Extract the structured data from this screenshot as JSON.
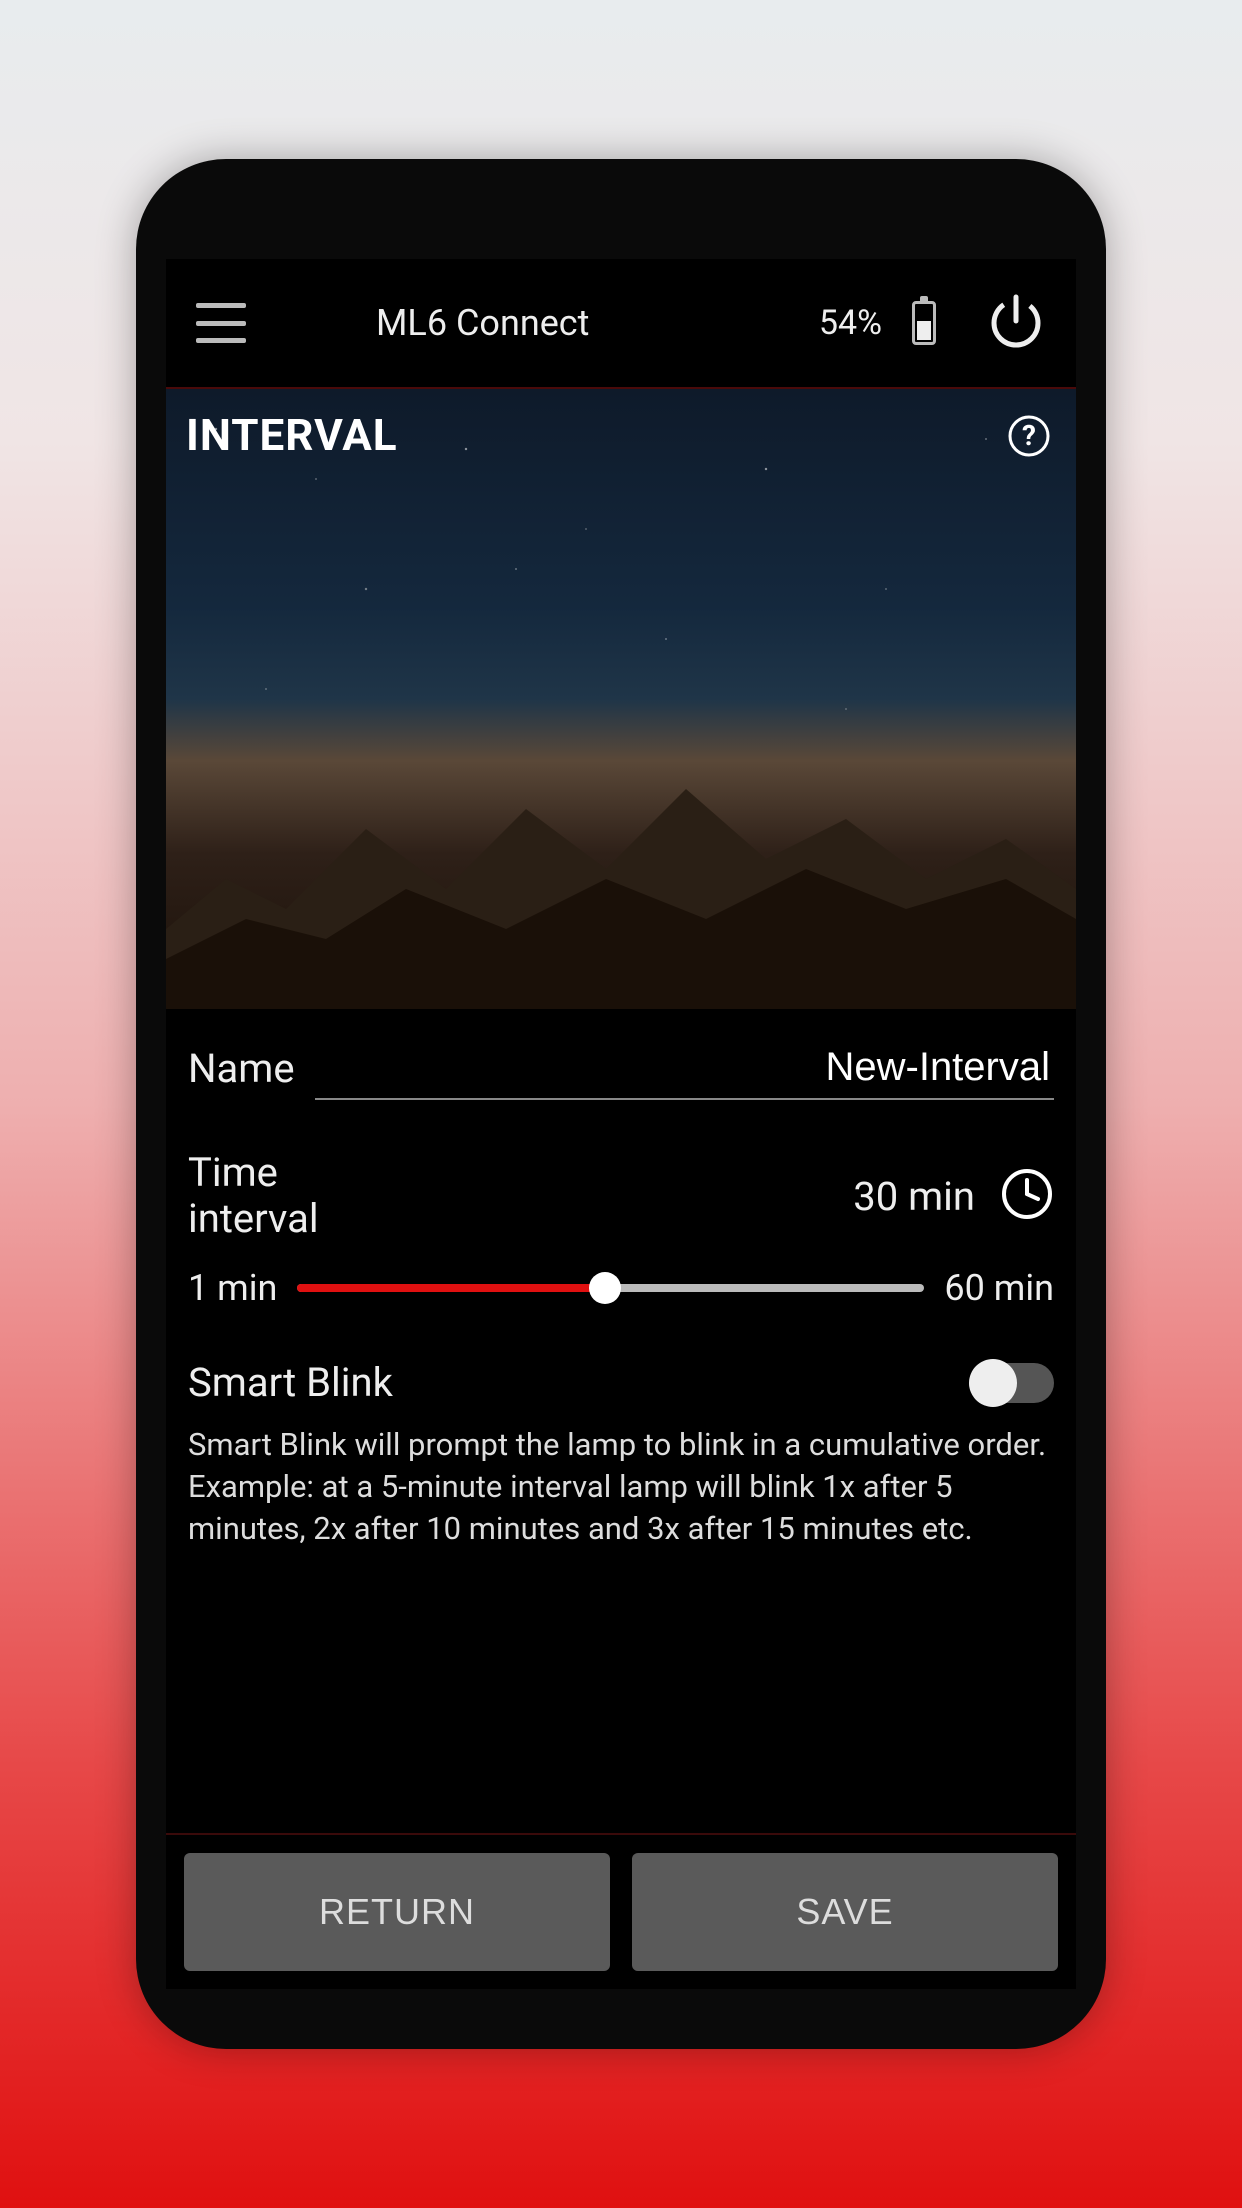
{
  "header": {
    "app_title": "ML6 Connect",
    "battery_pct": "54%"
  },
  "section": {
    "title": "INTERVAL"
  },
  "name_field": {
    "label": "Name",
    "value": "New-Interval"
  },
  "time_interval": {
    "label_line1": "Time",
    "label_line2": "interval",
    "value": "30 min",
    "min_label": "1 min",
    "max_label": "60 min",
    "min": 1,
    "max": 60,
    "current": 30
  },
  "smart_blink": {
    "label": "Smart Blink",
    "enabled": false,
    "description": "Smart Blink will prompt the lamp to blink in a cumulative order. Example: at a 5-minute interval lamp will blink 1x after 5 minutes, 2x after 10 minutes and 3x after 15 minutes etc."
  },
  "footer": {
    "return_label": "RETURN",
    "save_label": "SAVE"
  }
}
